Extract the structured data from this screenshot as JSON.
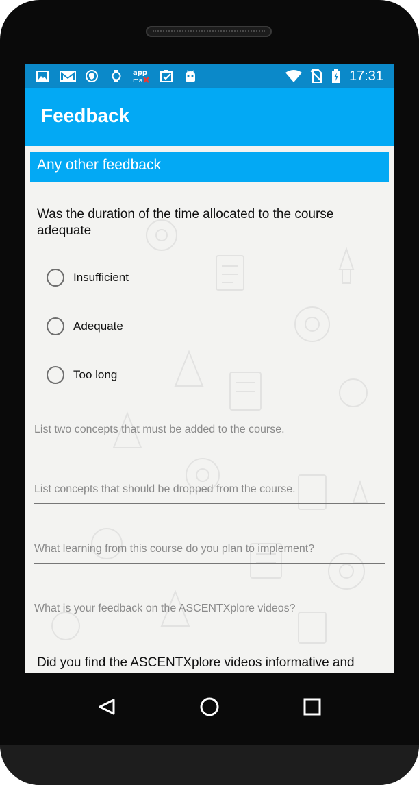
{
  "status_bar": {
    "time": "17:31",
    "icons": [
      "image-icon",
      "gmail-icon",
      "shield-icon",
      "watch-icon",
      "appmax-icon",
      "clipboard-icon",
      "android-icon",
      "wifi-icon",
      "no-sim-icon",
      "battery-charging-icon"
    ]
  },
  "app_bar": {
    "title": "Feedback"
  },
  "section": {
    "title": "Any other feedback"
  },
  "duration_question": {
    "text": "Was the duration of the time allocated to the course adequate",
    "options": [
      "Insufficient",
      "Adequate",
      "Too long"
    ]
  },
  "fields": {
    "concepts_add_placeholder": "List two concepts that must be added to the course.",
    "concepts_drop_placeholder": "List concepts that should be dropped from the course.",
    "implement_placeholder": "What learning from this course do you plan to implement?",
    "videos_feedback_placeholder": "What is your feedback on the ASCENTXplore videos?"
  },
  "videos_question": {
    "text": "Did you find the ASCENTXplore videos informative and"
  },
  "nav_bar": {
    "buttons": [
      "back-icon",
      "home-icon",
      "recents-icon"
    ]
  },
  "colors": {
    "status_bar": "#0b89c9",
    "app_bar": "#03a9f4",
    "section_bar": "#03a9f4",
    "background": "#f3f3f1"
  }
}
